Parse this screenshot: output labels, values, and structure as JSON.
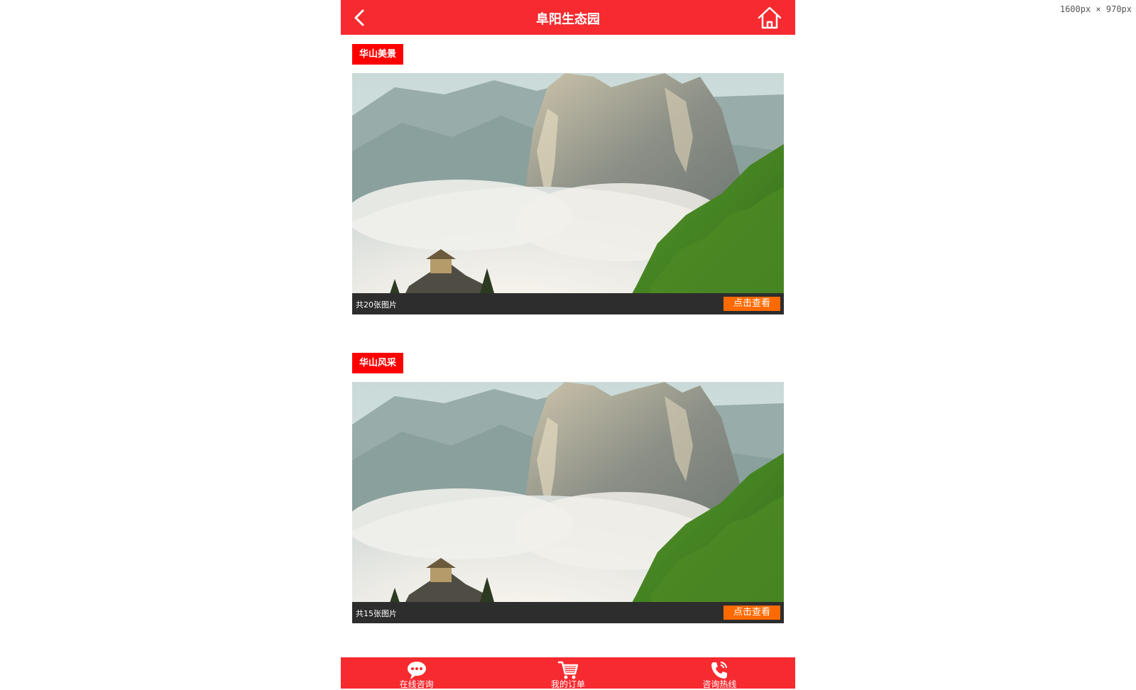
{
  "viewport_label": "1600px × 970px",
  "header": {
    "title": "阜阳生态园",
    "back_icon": "chevron-left-icon",
    "home_icon": "home-icon"
  },
  "sections": [
    {
      "tag": "华山美景",
      "count_text": "共20张图片",
      "view_label": "点击查看"
    },
    {
      "tag": "华山风采",
      "count_text": "共15张图片",
      "view_label": "点击查看"
    }
  ],
  "footer": {
    "items": [
      {
        "label": "在线咨询",
        "icon": "chat-bubble-icon"
      },
      {
        "label": "我的订单",
        "icon": "shopping-cart-icon"
      },
      {
        "label": "咨询热线",
        "icon": "phone-icon"
      }
    ]
  },
  "colors": {
    "header_red": "#f62a2f",
    "tag_red": "#ff0000",
    "button_orange": "#ff6a00",
    "caption_bar": "#2d2d2d"
  }
}
